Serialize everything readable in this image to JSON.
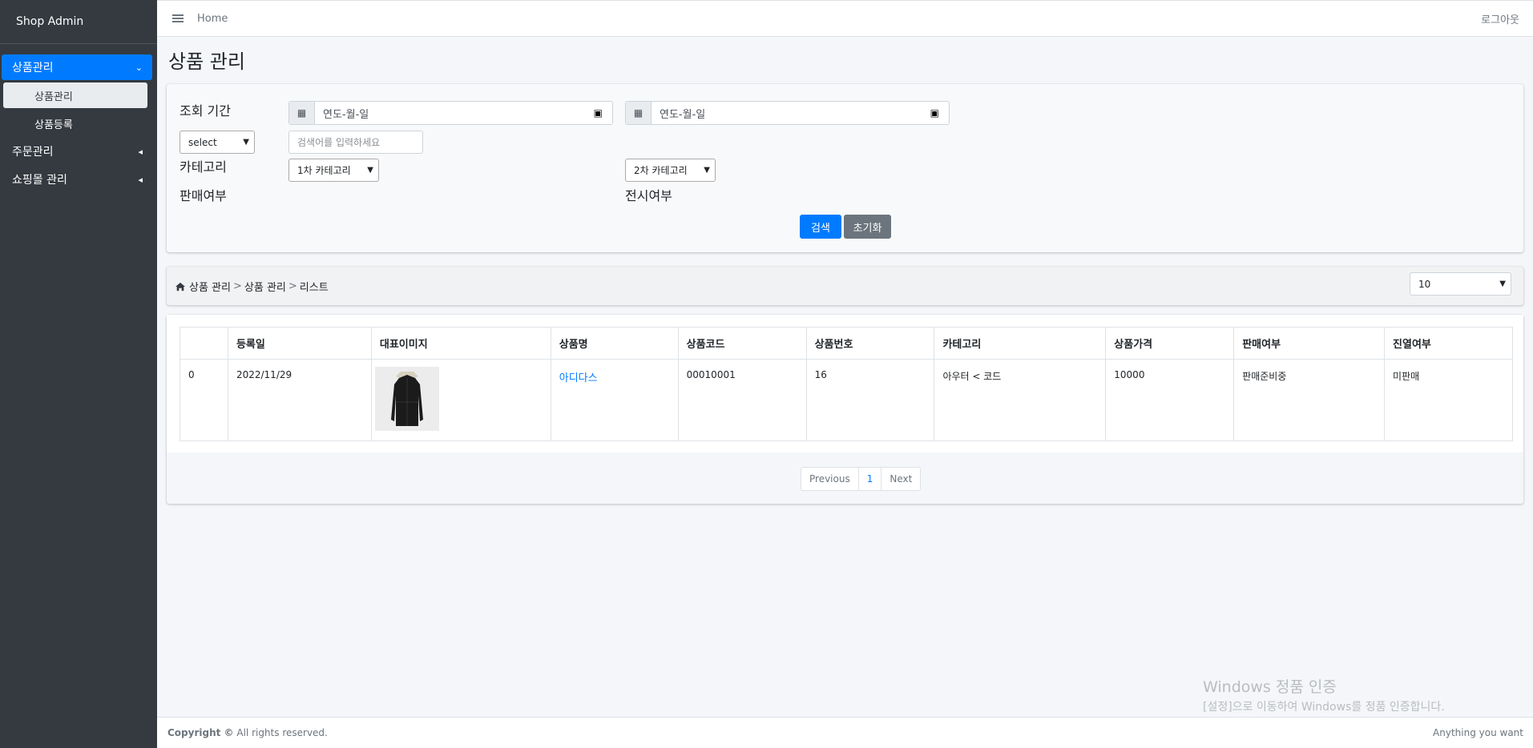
{
  "sidebar": {
    "brand": "Shop Admin",
    "menu": [
      {
        "label": "상품관리",
        "expanded": true,
        "children": [
          "상품관리",
          "상품등록"
        ]
      },
      {
        "label": "주문관리"
      },
      {
        "label": "쇼핑몰 관리"
      }
    ]
  },
  "topbar": {
    "home": "Home",
    "logout": "로그아웃"
  },
  "page": {
    "title": "상품 관리"
  },
  "search": {
    "period_label": "조회 기간",
    "date_placeholder_start": "연도-월-일",
    "date_placeholder_end": "연도-월-일",
    "keyword_select": "select",
    "keyword_placeholder": "검색어를 입력하세요",
    "category_label": "카테고리",
    "category1": "1차 카테고리",
    "category2": "2차 카테고리",
    "sale_label": "판매여부",
    "display_label": "전시여부",
    "search_button": "검색",
    "reset_button": "초기화"
  },
  "breadcrumb": {
    "items": [
      "상품 관리",
      "상품 관리",
      "리스트"
    ],
    "separator": ">"
  },
  "page_size": "10",
  "table": {
    "headers": [
      "",
      "등록일",
      "대표이미지",
      "상품명",
      "상품코드",
      "상품번호",
      "카테고리",
      "상품가격",
      "판매여부",
      "진열여부"
    ],
    "rows": [
      {
        "index": "0",
        "date": "2022/11/29",
        "image": "coat-image",
        "name": "아디다스",
        "code": "00010001",
        "number": "16",
        "category": "아우터 < 코드",
        "price": "10000",
        "sale": "판매준비중",
        "display": "미판매"
      }
    ]
  },
  "pagination": {
    "previous": "Previous",
    "current": "1",
    "next": "Next"
  },
  "footer": {
    "copyright_bold": "Copyright ©",
    "copyright_rest": "All rights reserved.",
    "right": "Anything you want"
  },
  "watermark": {
    "line1": "Windows 정품 인증",
    "line2": "[설정]으로 이동하여 Windows를 정품 인증합니다."
  },
  "colors": {
    "primary": "#007bff",
    "sidebar": "#343a40",
    "secondary": "#6c757d"
  }
}
